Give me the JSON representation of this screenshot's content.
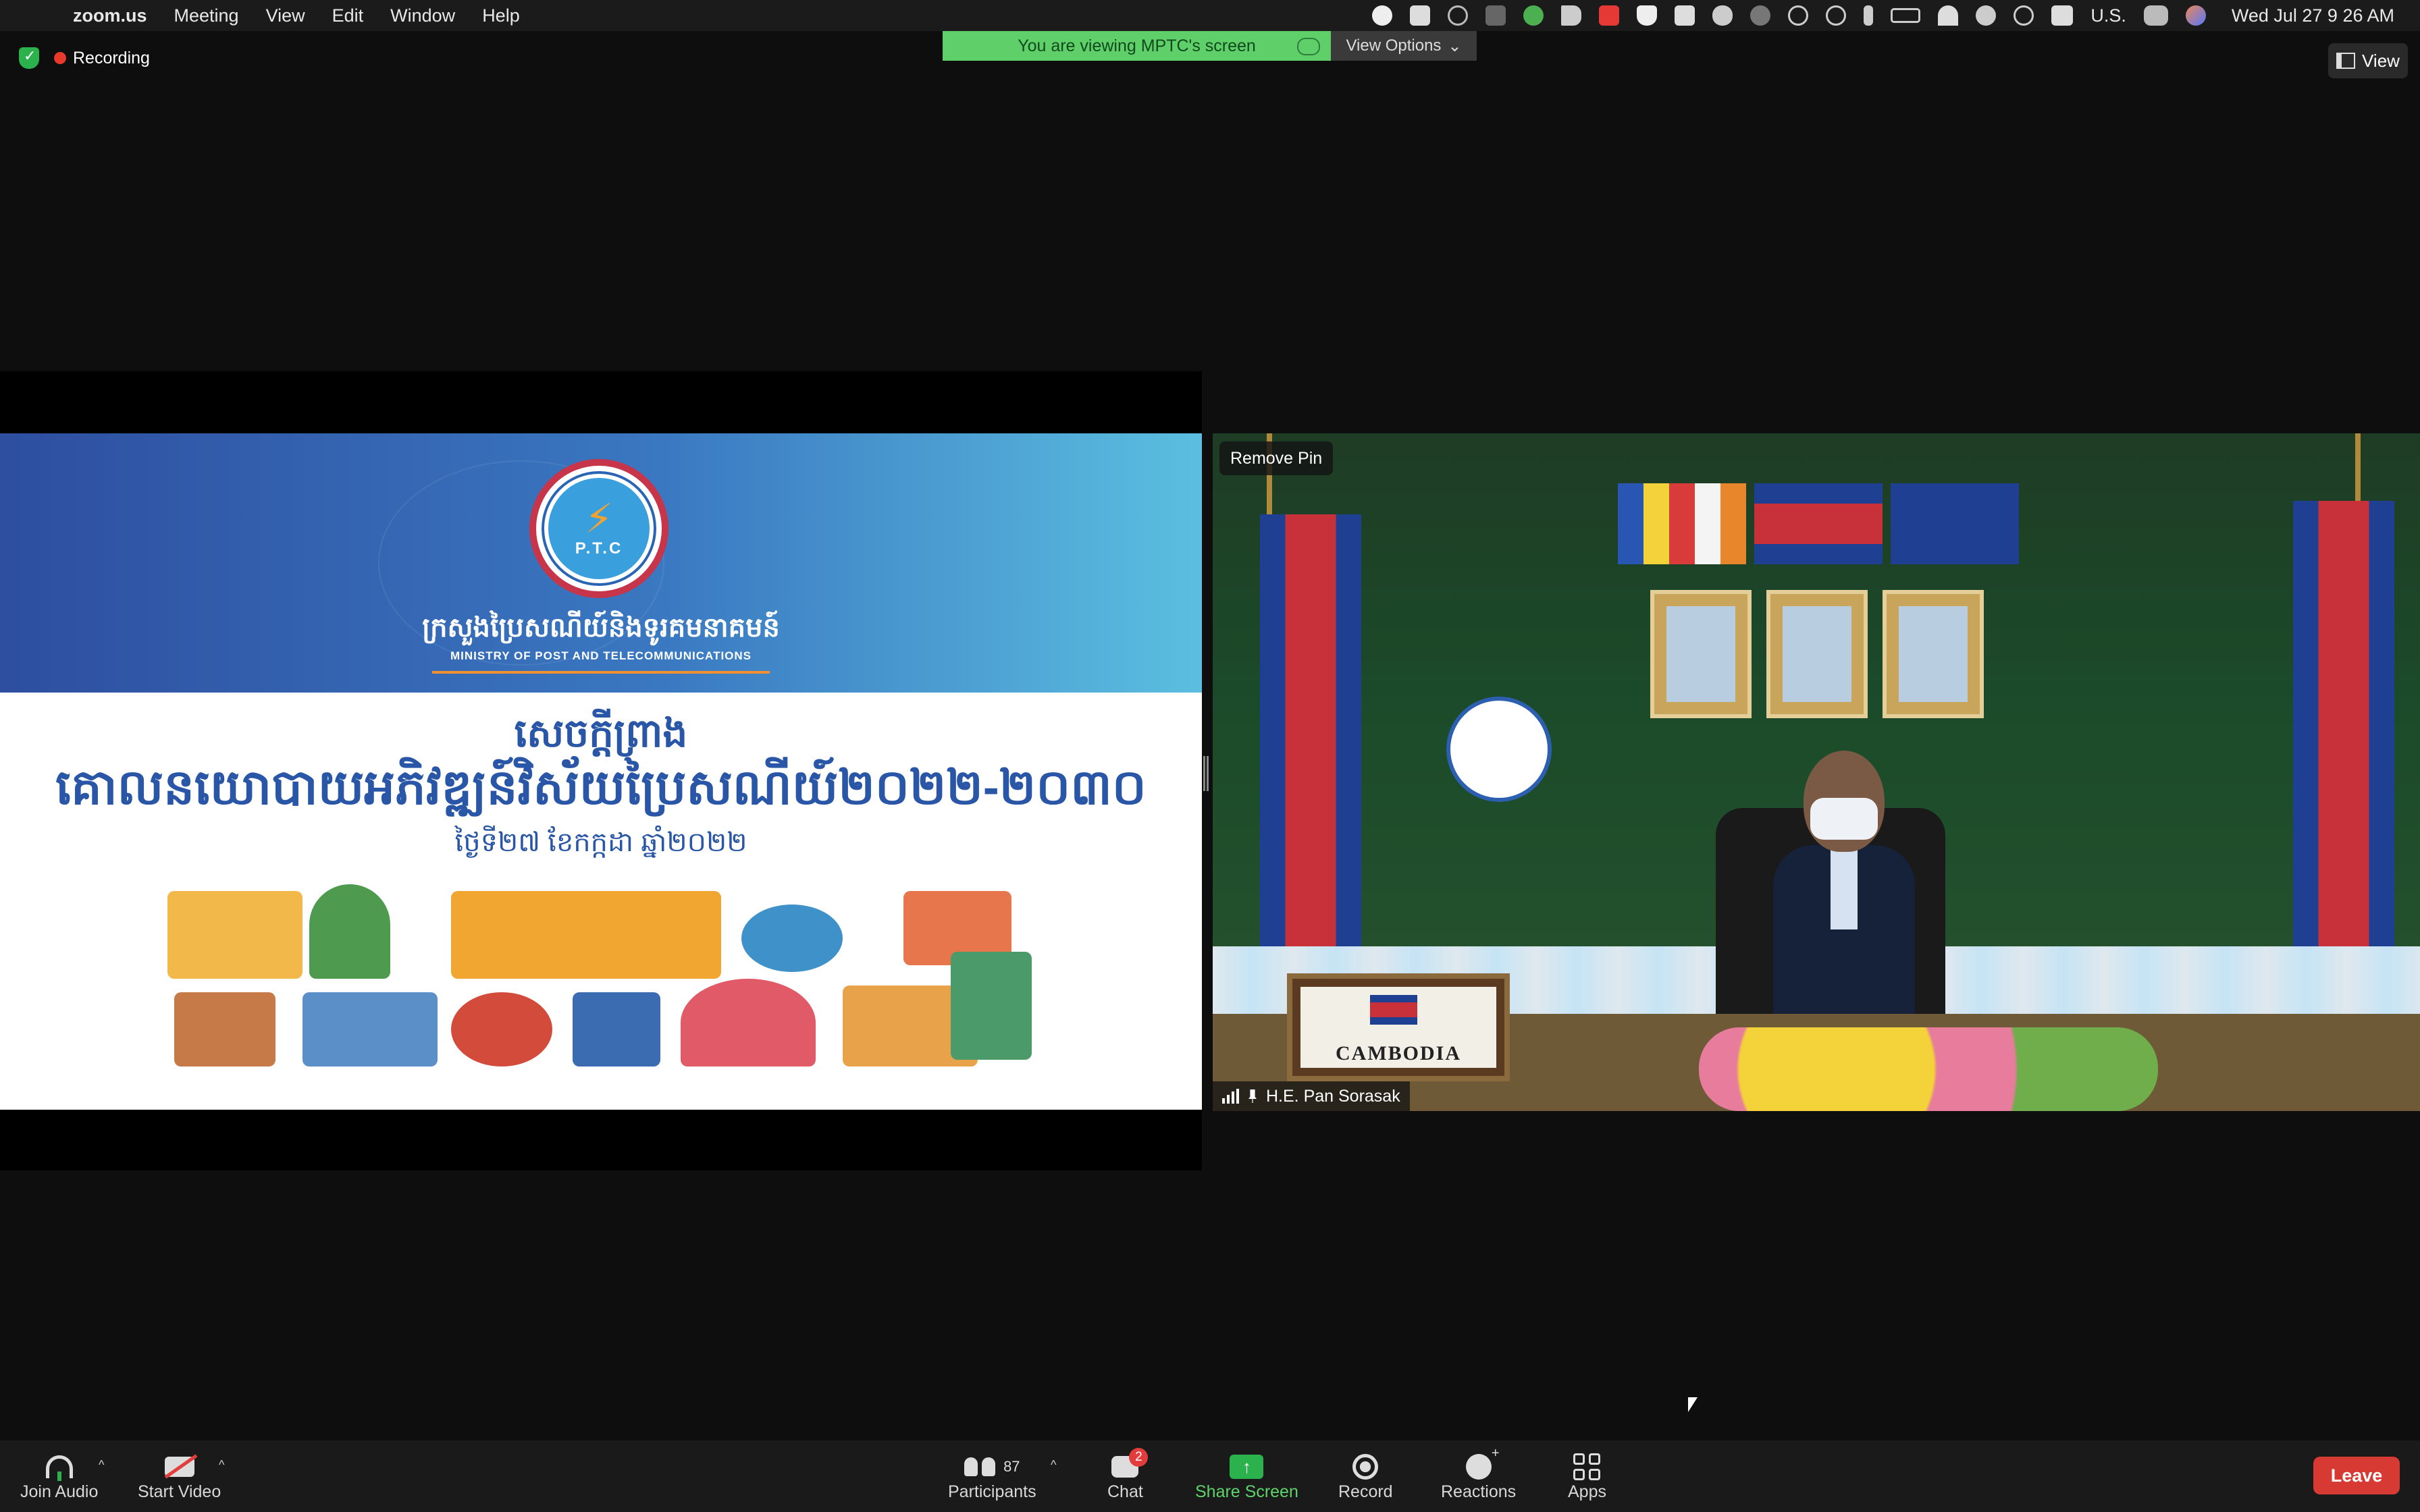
{
  "menubar": {
    "app": "zoom.us",
    "items": [
      "Meeting",
      "View",
      "Edit",
      "Window",
      "Help"
    ],
    "input_source": "U.S.",
    "clock": "Wed Jul 27  9 26 AM"
  },
  "recording": {
    "label": "Recording"
  },
  "banner": {
    "text": "You are viewing MPTC's screen",
    "view_options": "View Options"
  },
  "view_button": "View",
  "slide": {
    "logo_text": "P.T.C",
    "ministry_kh": "ក្រសួងប្រៃសណីយ៍និងទូរគមនាគមន៍",
    "ministry_en": "MINISTRY OF POST AND TELECOMMUNICATIONS",
    "title_1": "សេចក្តីព្រាង",
    "title_2": "គោលនយោបាយអភិវឌ្ឍន៍វិស័យប្រៃសណីយ៍២០២២-២០៣០",
    "date": "ថ្ងៃទី២៧ ខែកក្កដា ឆ្នាំ២០២២"
  },
  "video": {
    "remove_pin": "Remove Pin",
    "participant_name": "H.E. Pan Sorasak",
    "nameplate": "CAMBODIA"
  },
  "toolbar": {
    "join_audio": "Join Audio",
    "start_video": "Start Video",
    "participants": "Participants",
    "participants_count": "87",
    "chat": "Chat",
    "chat_badge": "2",
    "share_screen": "Share Screen",
    "record": "Record",
    "reactions": "Reactions",
    "apps": "Apps",
    "leave": "Leave"
  },
  "colors": {
    "accent_green": "#2bb24c",
    "leave_red": "#d63a33",
    "slide_blue": "#2956a6"
  }
}
